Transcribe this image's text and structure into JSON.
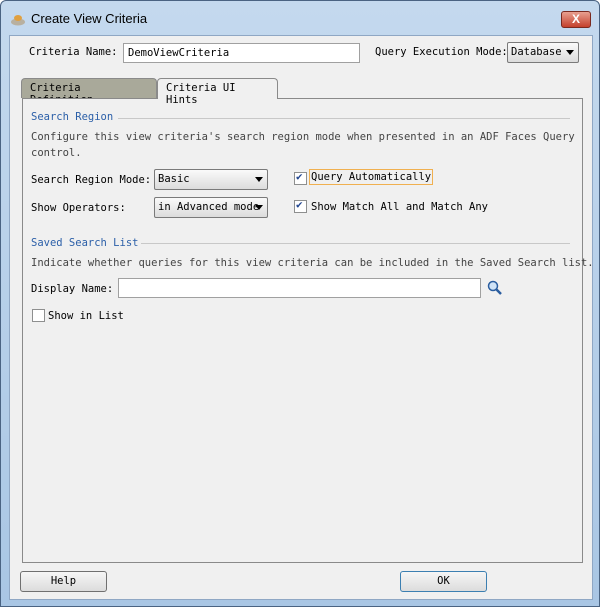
{
  "window": {
    "title": "Create View Criteria",
    "close_label": "X"
  },
  "header": {
    "criteria_name_label": "Criteria Name:",
    "criteria_name_value": "DemoViewCriteria",
    "query_mode_label": "Query Execution Mode:",
    "query_mode_value": "Database"
  },
  "tabs": [
    {
      "label": "Criteria Definition",
      "active": false
    },
    {
      "label": "Criteria UI Hints",
      "active": true
    }
  ],
  "search_region": {
    "title": "Search Region",
    "description_line1": "Configure this view criteria's search region mode when presented in an ADF Faces Query",
    "description_line2": "control.",
    "mode_label": "Search Region Mode:",
    "mode_value": "Basic",
    "operators_label": "Show Operators:",
    "operators_value": "in Advanced mode",
    "query_auto_label": "Query Automatically",
    "query_auto_checked": true,
    "match_label": "Show Match All and Match Any",
    "match_checked": true
  },
  "saved_search": {
    "title": "Saved Search List",
    "description": "Indicate whether queries for this view criteria can be included in the Saved Search list.",
    "display_name_label": "Display Name:",
    "display_name_value": "",
    "show_in_list_label": "Show in List",
    "show_in_list_checked": false
  },
  "footer": {
    "help_label": "Help",
    "ok_label": "OK"
  }
}
